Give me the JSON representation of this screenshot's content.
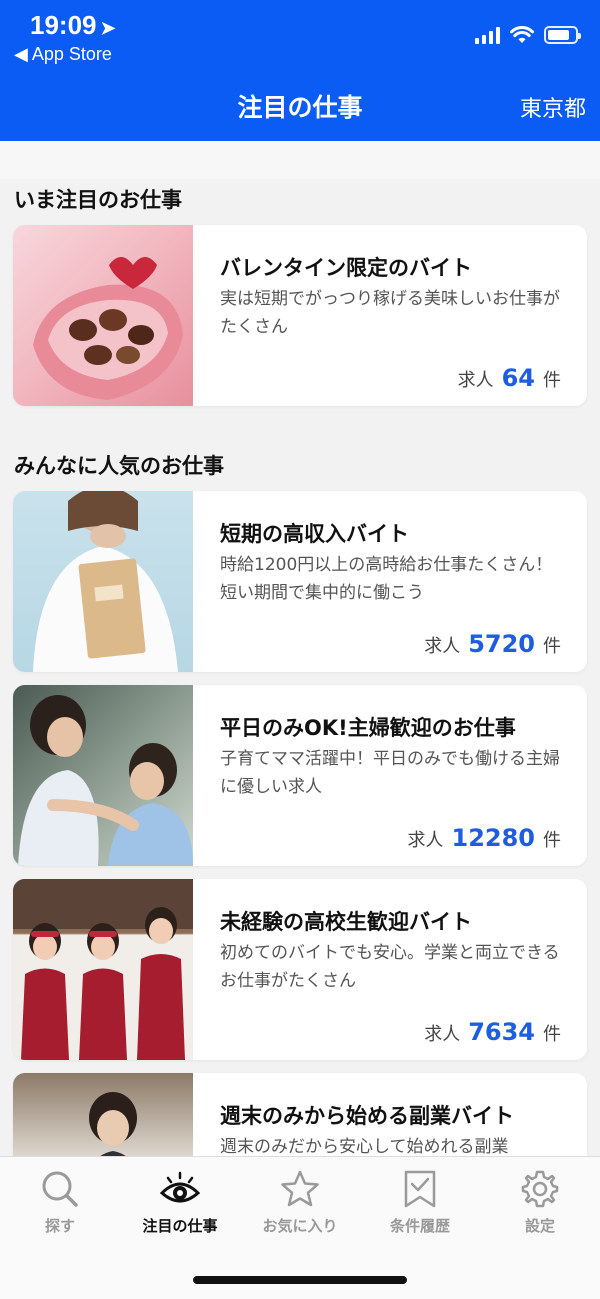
{
  "status_bar": {
    "time": "19:09",
    "back_label": "◀ App Store"
  },
  "header": {
    "title": "注目の仕事",
    "location": "東京都"
  },
  "sections": [
    {
      "title": "いま注目のお仕事",
      "cards": [
        {
          "name": "バレンタイン限定のバイト",
          "desc": "実は短期でがっつり稼げる美味しいお仕事がたくさん",
          "count_prefix": "求人",
          "count": "64",
          "count_suffix": "件"
        }
      ]
    },
    {
      "title": "みんなに人気のお仕事",
      "cards": [
        {
          "name": "短期の高収入バイト",
          "desc": "時給1200円以上の高時給お仕事たくさん！短い期間で集中的に働こう",
          "count_prefix": "求人",
          "count": "5720",
          "count_suffix": "件"
        },
        {
          "name": "平日のみOK!主婦歓迎のお仕事",
          "desc": "子育てママ活躍中！平日のみでも働ける主婦に優しい求人",
          "count_prefix": "求人",
          "count": "12280",
          "count_suffix": "件"
        },
        {
          "name": "未経験の高校生歓迎バイト",
          "desc": "初めてのバイトでも安心。学業と両立できるお仕事がたくさん",
          "count_prefix": "求人",
          "count": "7634",
          "count_suffix": "件"
        },
        {
          "name": "週末のみから始める副業バイト",
          "desc": "週末のみだから安心して始めれる副業",
          "count_prefix": "",
          "count": "",
          "count_suffix": ""
        }
      ]
    }
  ],
  "tabs": [
    {
      "label": "探す",
      "icon": "search-icon"
    },
    {
      "label": "注目の仕事",
      "icon": "eye-icon",
      "active": true
    },
    {
      "label": "お気に入り",
      "icon": "star-icon"
    },
    {
      "label": "条件履歴",
      "icon": "bookmark-check-icon"
    },
    {
      "label": "設定",
      "icon": "gear-icon"
    }
  ],
  "colors": {
    "header": "#0a5cf5",
    "count": "#1f5de0"
  }
}
